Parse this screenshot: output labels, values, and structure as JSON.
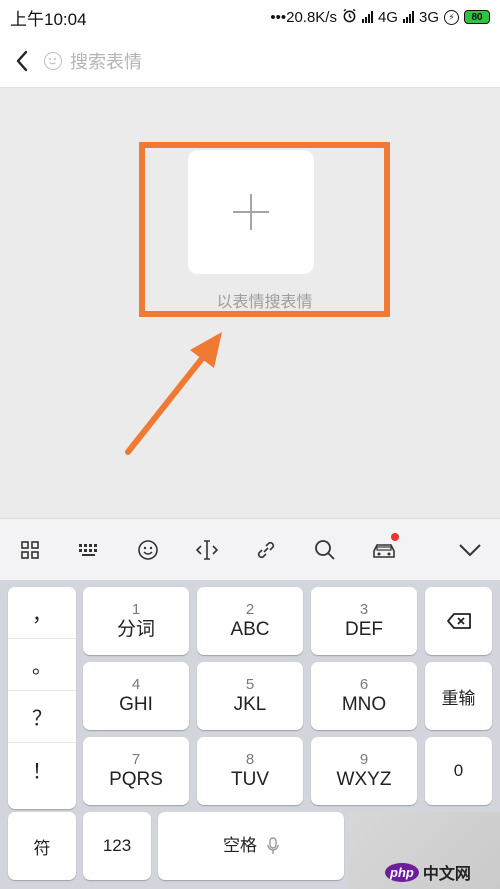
{
  "status_bar": {
    "time": "上午10:04",
    "speed": "•••20.8K/s",
    "net1": "4G",
    "net2": "3G",
    "battery": "80"
  },
  "search": {
    "placeholder": "搜索表情"
  },
  "content": {
    "hint": "以表情搜表情"
  },
  "colors": {
    "highlight": "#f07a33",
    "battery": "#2fc440"
  },
  "toolbar": {
    "icons": [
      "grid-icon",
      "keyboard-icon",
      "emoji-icon",
      "cursor-icon",
      "link-icon",
      "search-icon",
      "car-icon",
      "chevron-down-icon"
    ]
  },
  "keyboard": {
    "punctuation": [
      "，",
      "。",
      "？",
      "！"
    ],
    "keys": {
      "k1": {
        "num": "1",
        "label": "分词"
      },
      "k2": {
        "num": "2",
        "label": "ABC"
      },
      "k3": {
        "num": "3",
        "label": "DEF"
      },
      "k4": {
        "num": "4",
        "label": "GHI"
      },
      "k5": {
        "num": "5",
        "label": "JKL"
      },
      "k6": {
        "num": "6",
        "label": "MNO"
      },
      "k7": {
        "num": "7",
        "label": "PQRS"
      },
      "k8": {
        "num": "8",
        "label": "TUV"
      },
      "k9": {
        "num": "9",
        "label": "WXYZ"
      }
    },
    "reenter": "重输",
    "zero": "0",
    "symbol": "符",
    "num_mode": "123",
    "space": "空格"
  },
  "watermark": {
    "logo": "php",
    "text": "中文网"
  }
}
